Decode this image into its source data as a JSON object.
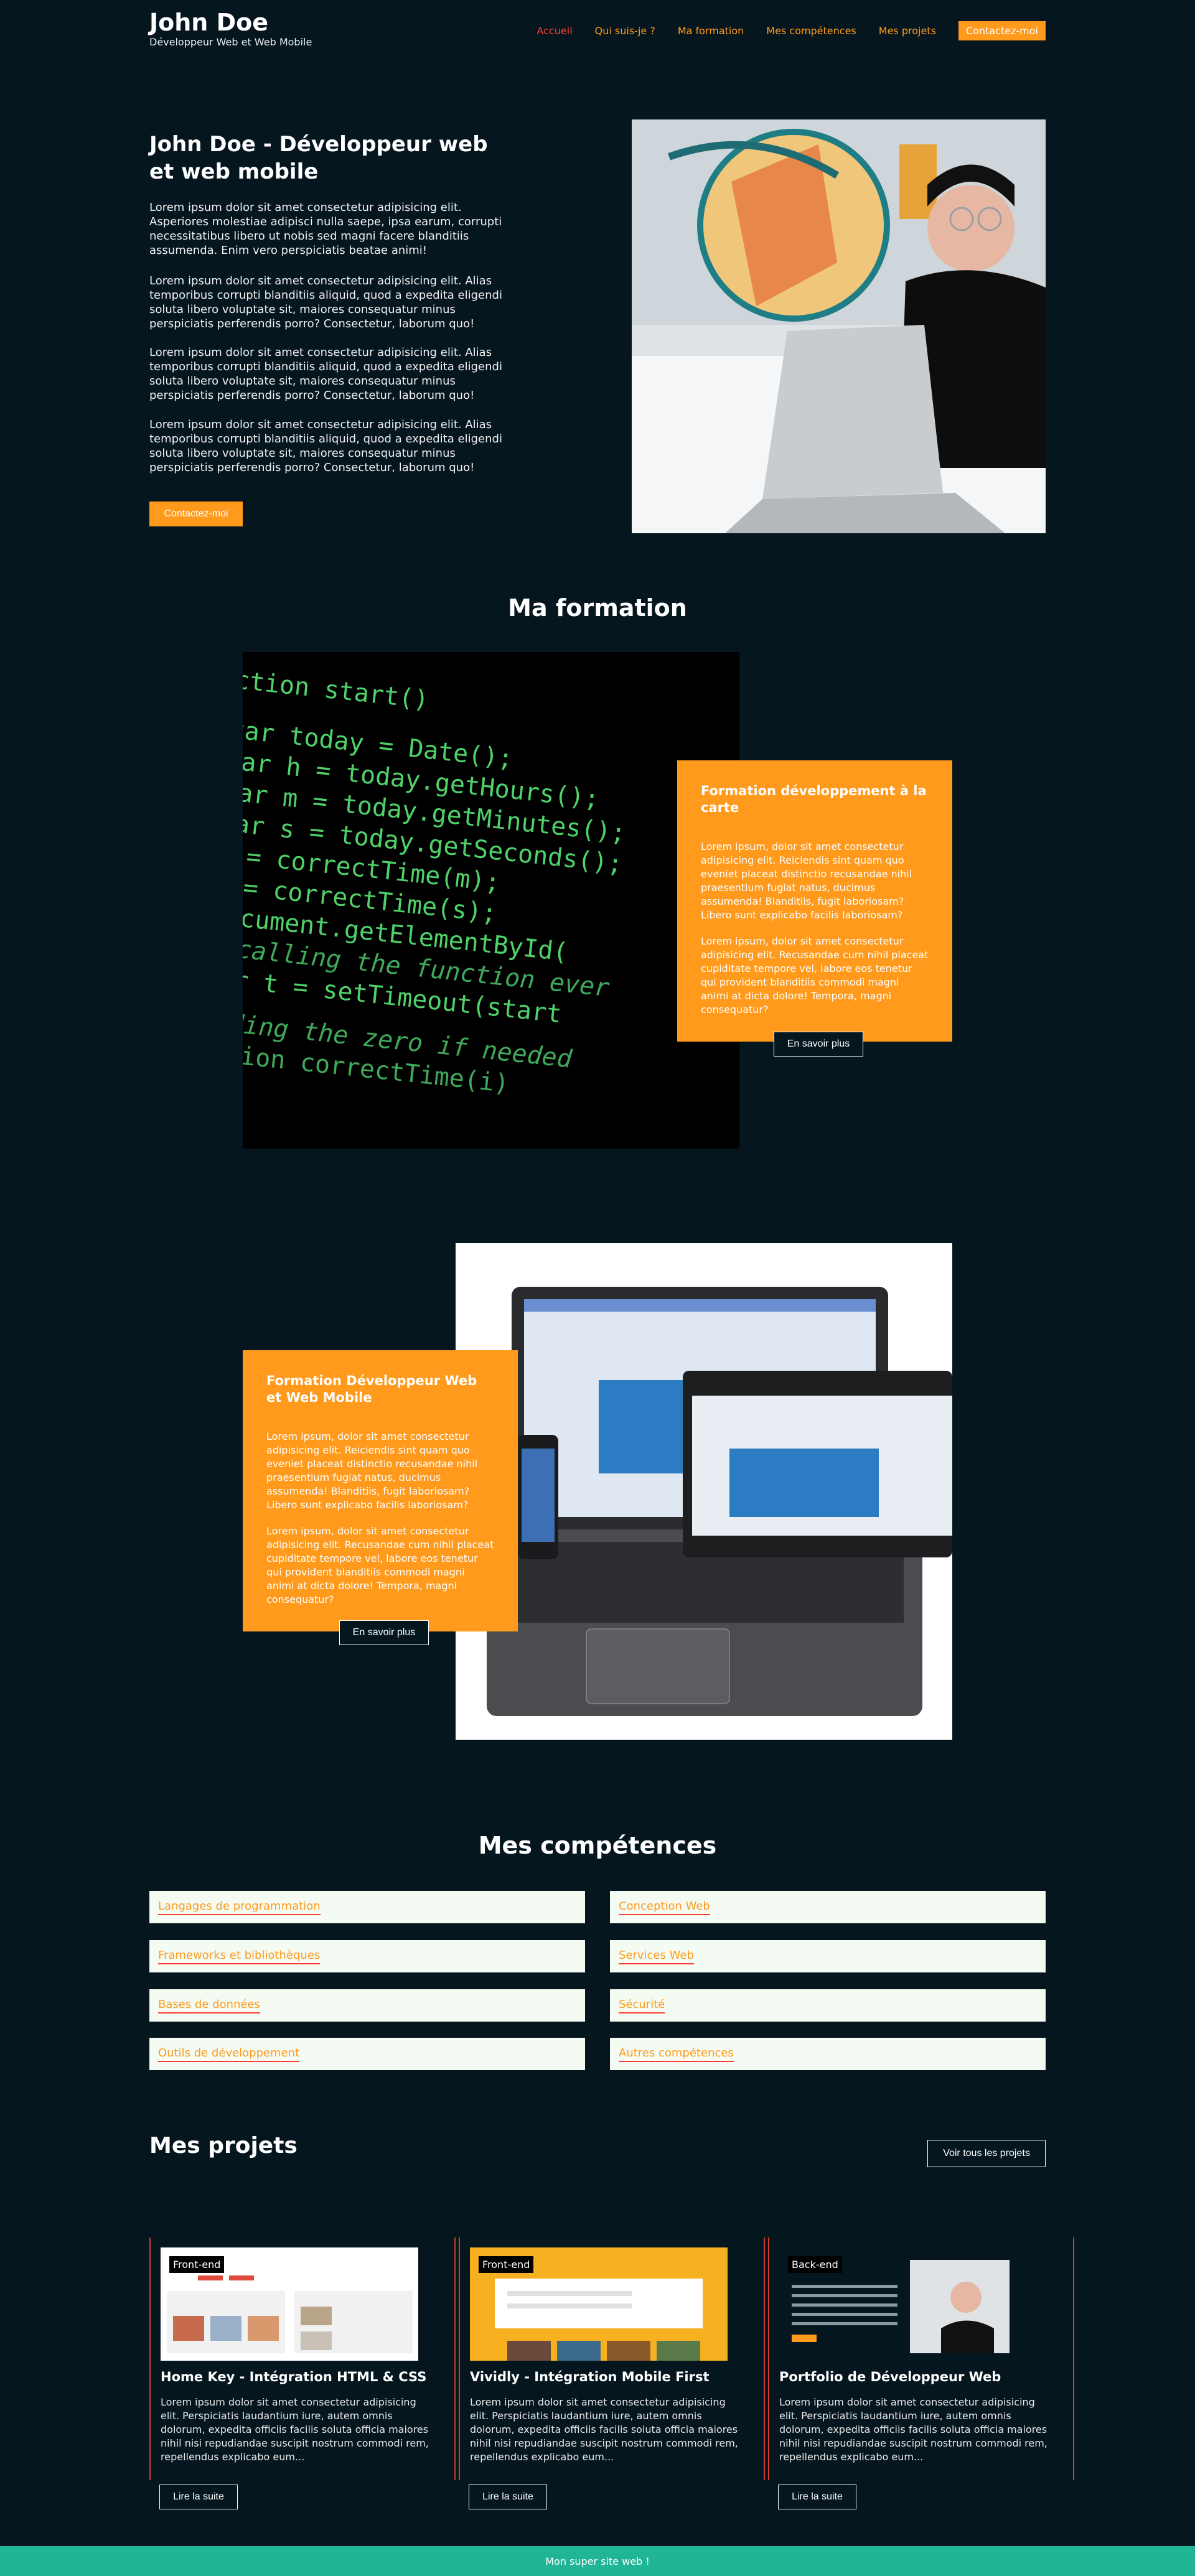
{
  "header": {
    "name": "John Doe",
    "tagline": "Développeur Web et Web Mobile",
    "nav": [
      "Accueil",
      "Qui suis-je ?",
      "Ma formation",
      "Mes compétences",
      "Mes projets"
    ],
    "cta": "Contactez-moi"
  },
  "hero": {
    "title": "John Doe - Développeur web et web mobile",
    "paragraphs": [
      "Lorem ipsum dolor sit amet consectetur adipisicing elit. Asperiores molestiae adipisci nulla saepe, ipsa earum, corrupti necessitatibus libero ut nobis sed magni facere blanditiis assumenda. Enim vero perspiciatis beatae animi!",
      "Lorem ipsum dolor sit amet consectetur adipisicing elit. Alias temporibus corrupti blanditiis aliquid, quod a expedita eligendi soluta libero voluptate sit, maiores consequatur minus perspiciatis perferendis porro? Consectetur, laborum quo!",
      "Lorem ipsum dolor sit amet consectetur adipisicing elit. Alias temporibus corrupti blanditiis aliquid, quod a expedita eligendi soluta libero voluptate sit, maiores consequatur minus perspiciatis perferendis porro? Consectetur, laborum quo!",
      "Lorem ipsum dolor sit amet consectetur adipisicing elit. Alias temporibus corrupti blanditiis aliquid, quod a expedita eligendi soluta libero voluptate sit, maiores consequatur minus perspiciatis perferendis porro? Consectetur, laborum quo!"
    ],
    "button": "Contactez-moi"
  },
  "formation": {
    "title": "Ma formation",
    "code_lines": [
      "ction start()",
      "var today = Date();",
      "var h = today.getHours();",
      "var m = today.getMinutes();",
      "var s = today.getSeconds();",
      "m = correctTime(m);",
      "s = correctTime(s);",
      "document.getElementById(",
      "//calling the function ever",
      "var t = setTimeout(start",
      "adding the zero if needed",
      "nction correctTime(i)"
    ],
    "cards": [
      {
        "title": "Formation développement à la carte",
        "p1": "Lorem ipsum, dolor sit amet consectetur adipisicing elit. Reiciendis sint quam quo eveniet placeat distinctio recusandae nihil praesentium fugiat natus, ducimus assumenda! Blanditiis, fugit laboriosam? Libero sunt explicabo facilis laboriosam?",
        "p2": "Lorem ipsum, dolor sit amet consectetur adipisicing elit. Recusandae cum nihil placeat cupiditate tempore vel, labore eos tenetur qui provident blanditiis commodi magni animi at dicta dolore! Tempora, magni consequatur?",
        "button": "En savoir plus"
      },
      {
        "title": "Formation Développeur Web et Web Mobile",
        "p1": "Lorem ipsum, dolor sit amet consectetur adipisicing elit. Reiciendis sint quam quo eveniet placeat distinctio recusandae nihil praesentium fugiat natus, ducimus assumenda! Blanditiis, fugit laboriosam? Libero sunt explicabo facilis laboriosam?",
        "p2": "Lorem ipsum, dolor sit amet consectetur adipisicing elit. Recusandae cum nihil placeat cupiditate tempore vel, labore eos tenetur qui provident blanditiis commodi magni animi at dicta dolore! Tempora, magni consequatur?",
        "button": "En savoir plus"
      }
    ]
  },
  "skills": {
    "title": "Mes compétences",
    "left": [
      "Langages de programmation",
      "Frameworks et bibliothèques",
      "Bases de données",
      "Outils de développement"
    ],
    "right": [
      "Conception Web",
      "Services Web",
      "Sécurité",
      "Autres compétences"
    ]
  },
  "projects": {
    "title": "Mes projets",
    "view_all": "Voir tous les projets",
    "items": [
      {
        "badge": "Front-end",
        "title": "Home Key - Intégration HTML & CSS",
        "text": "Lorem ipsum dolor sit amet consectetur adipisicing elit. Perspiciatis laudantium iure, autem omnis dolorum, expedita officiis facilis soluta officia maiores nihil nisi repudiandae suscipit nostrum commodi rem, repellendus explicabo eum...",
        "button": "Lire la suite"
      },
      {
        "badge": "Front-end",
        "title": "Vividly - Intégration Mobile First",
        "text": "Lorem ipsum dolor sit amet consectetur adipisicing elit. Perspiciatis laudantium iure, autem omnis dolorum, expedita officiis facilis soluta officia maiores nihil nisi repudiandae suscipit nostrum commodi rem, repellendus explicabo eum...",
        "button": "Lire la suite"
      },
      {
        "badge": "Back-end",
        "title": "Portfolio de Développeur Web",
        "text": "Lorem ipsum dolor sit amet consectetur adipisicing elit. Perspiciatis laudantium iure, autem omnis dolorum, expedita officiis facilis soluta officia maiores nihil nisi repudiandae suscipit nostrum commodi rem, repellendus explicabo eum...",
        "button": "Lire la suite"
      }
    ]
  },
  "footer": {
    "text": "Mon super site web !"
  },
  "colors": {
    "background": "#05161f",
    "accent": "#ff9a1d",
    "active": "#ff3b2f",
    "footer": "#1fb596",
    "skill_bg": "#f4fbf2"
  }
}
